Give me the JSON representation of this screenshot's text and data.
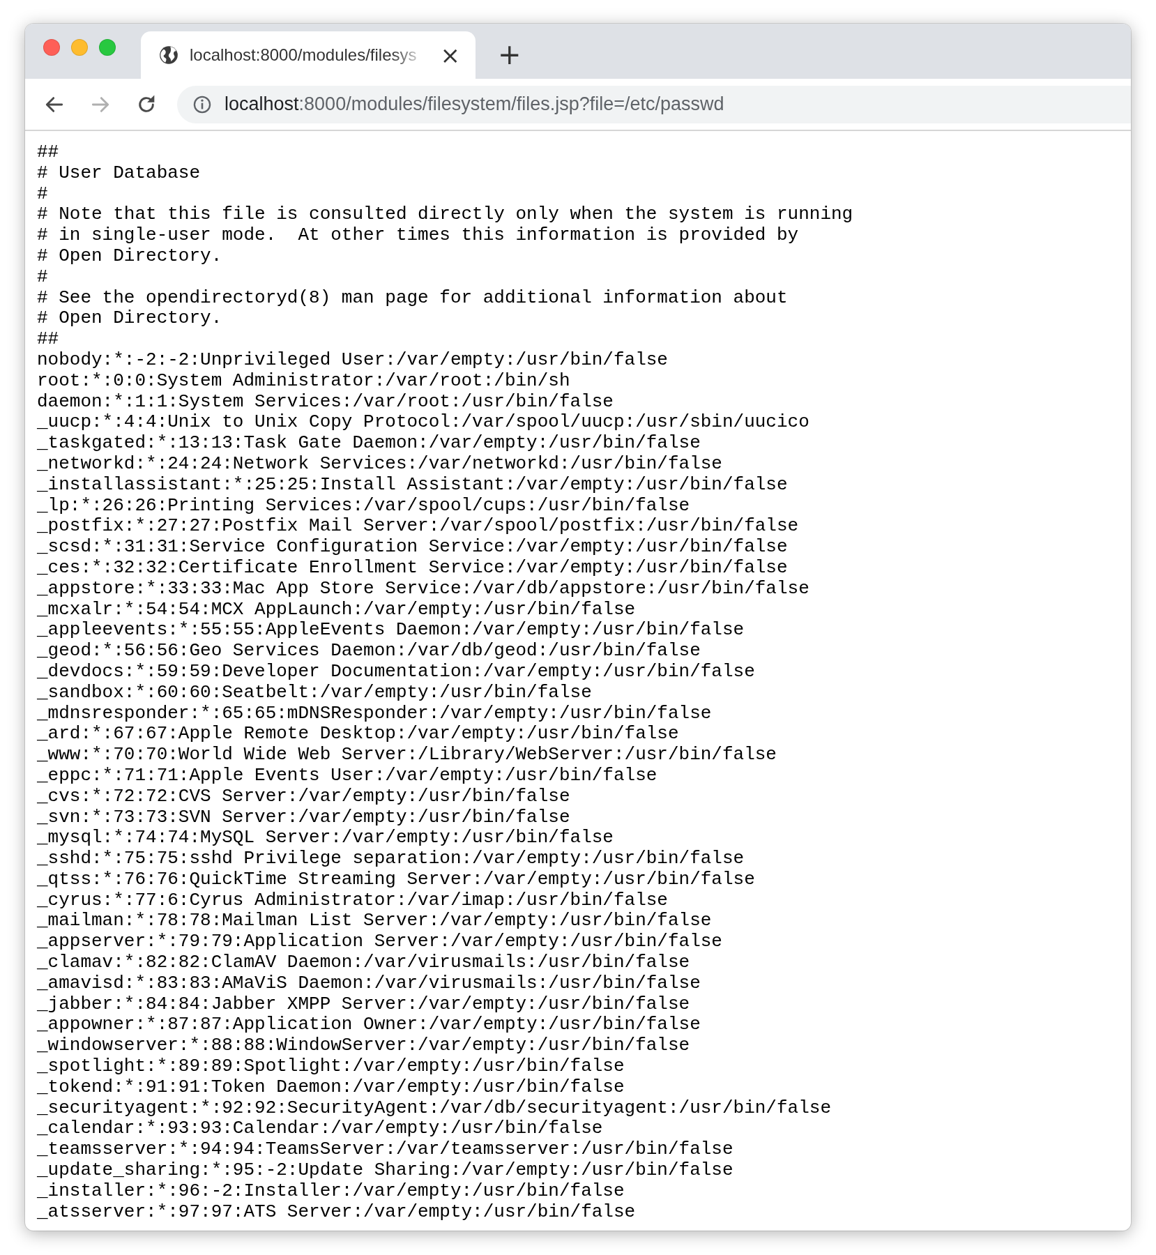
{
  "window": {
    "controls": [
      {
        "color": "#fe5f57"
      },
      {
        "color": "#febc2e"
      },
      {
        "color": "#28c840"
      }
    ]
  },
  "tabs": [
    {
      "title": "localhost:8000/modules/filesys",
      "close": "×",
      "selected": true
    }
  ],
  "new_tab": "+",
  "toolbar": {
    "back_enabled": true,
    "forward_enabled": false
  },
  "address_bar": {
    "host": "localhost",
    "path": ":8000/modules/filesystem/files.jsp?file=/etc/passwd"
  },
  "content": {
    "lines": [
      "##",
      "# User Database",
      "#",
      "# Note that this file is consulted directly only when the system is running",
      "# in single-user mode.  At other times this information is provided by",
      "# Open Directory.",
      "#",
      "# See the opendirectoryd(8) man page for additional information about",
      "# Open Directory.",
      "##",
      "nobody:*:-2:-2:Unprivileged User:/var/empty:/usr/bin/false",
      "root:*:0:0:System Administrator:/var/root:/bin/sh",
      "daemon:*:1:1:System Services:/var/root:/usr/bin/false",
      "_uucp:*:4:4:Unix to Unix Copy Protocol:/var/spool/uucp:/usr/sbin/uucico",
      "_taskgated:*:13:13:Task Gate Daemon:/var/empty:/usr/bin/false",
      "_networkd:*:24:24:Network Services:/var/networkd:/usr/bin/false",
      "_installassistant:*:25:25:Install Assistant:/var/empty:/usr/bin/false",
      "_lp:*:26:26:Printing Services:/var/spool/cups:/usr/bin/false",
      "_postfix:*:27:27:Postfix Mail Server:/var/spool/postfix:/usr/bin/false",
      "_scsd:*:31:31:Service Configuration Service:/var/empty:/usr/bin/false",
      "_ces:*:32:32:Certificate Enrollment Service:/var/empty:/usr/bin/false",
      "_appstore:*:33:33:Mac App Store Service:/var/db/appstore:/usr/bin/false",
      "_mcxalr:*:54:54:MCX AppLaunch:/var/empty:/usr/bin/false",
      "_appleevents:*:55:55:AppleEvents Daemon:/var/empty:/usr/bin/false",
      "_geod:*:56:56:Geo Services Daemon:/var/db/geod:/usr/bin/false",
      "_devdocs:*:59:59:Developer Documentation:/var/empty:/usr/bin/false",
      "_sandbox:*:60:60:Seatbelt:/var/empty:/usr/bin/false",
      "_mdnsresponder:*:65:65:mDNSResponder:/var/empty:/usr/bin/false",
      "_ard:*:67:67:Apple Remote Desktop:/var/empty:/usr/bin/false",
      "_www:*:70:70:World Wide Web Server:/Library/WebServer:/usr/bin/false",
      "_eppc:*:71:71:Apple Events User:/var/empty:/usr/bin/false",
      "_cvs:*:72:72:CVS Server:/var/empty:/usr/bin/false",
      "_svn:*:73:73:SVN Server:/var/empty:/usr/bin/false",
      "_mysql:*:74:74:MySQL Server:/var/empty:/usr/bin/false",
      "_sshd:*:75:75:sshd Privilege separation:/var/empty:/usr/bin/false",
      "_qtss:*:76:76:QuickTime Streaming Server:/var/empty:/usr/bin/false",
      "_cyrus:*:77:6:Cyrus Administrator:/var/imap:/usr/bin/false",
      "_mailman:*:78:78:Mailman List Server:/var/empty:/usr/bin/false",
      "_appserver:*:79:79:Application Server:/var/empty:/usr/bin/false",
      "_clamav:*:82:82:ClamAV Daemon:/var/virusmails:/usr/bin/false",
      "_amavisd:*:83:83:AMaViS Daemon:/var/virusmails:/usr/bin/false",
      "_jabber:*:84:84:Jabber XMPP Server:/var/empty:/usr/bin/false",
      "_appowner:*:87:87:Application Owner:/var/empty:/usr/bin/false",
      "_windowserver:*:88:88:WindowServer:/var/empty:/usr/bin/false",
      "_spotlight:*:89:89:Spotlight:/var/empty:/usr/bin/false",
      "_tokend:*:91:91:Token Daemon:/var/empty:/usr/bin/false",
      "_securityagent:*:92:92:SecurityAgent:/var/db/securityagent:/usr/bin/false",
      "_calendar:*:93:93:Calendar:/var/empty:/usr/bin/false",
      "_teamsserver:*:94:94:TeamsServer:/var/teamsserver:/usr/bin/false",
      "_update_sharing:*:95:-2:Update Sharing:/var/empty:/usr/bin/false",
      "_installer:*:96:-2:Installer:/var/empty:/usr/bin/false",
      "_atsserver:*:97:97:ATS Server:/var/empty:/usr/bin/false"
    ]
  }
}
